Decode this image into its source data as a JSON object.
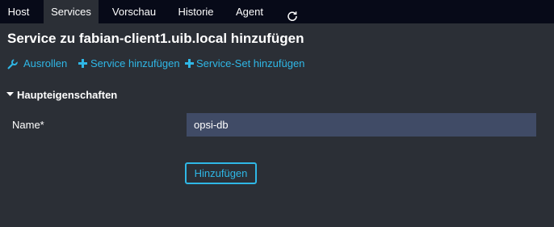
{
  "tabs": [
    {
      "label": "Host",
      "active": false
    },
    {
      "label": "Services",
      "active": true
    },
    {
      "label": "Vorschau",
      "active": false
    },
    {
      "label": "Historie",
      "active": false
    },
    {
      "label": "Agent",
      "active": false
    }
  ],
  "refresh_icon": "refresh-icon",
  "page_title": "Service zu fabian-client1.uib.local hinzufügen",
  "actions": {
    "rollout": {
      "label": "Ausrollen",
      "icon": "wrench-icon"
    },
    "add_service": {
      "label": "Service hinzufügen",
      "icon": "plus-icon"
    },
    "add_service_set": {
      "label": "Service-Set hinzufügen",
      "icon": "plus-icon"
    }
  },
  "section": {
    "label": "Haupteigenschaften",
    "icon": "caret-down-icon"
  },
  "form": {
    "name_label": "Name*",
    "name_value": "opsi-db",
    "submit_label": "Hinzufügen"
  },
  "colors": {
    "topbar": "#070a18",
    "background": "#2b2f36",
    "accent": "#2fb7e6",
    "input_bg": "#404b66"
  }
}
